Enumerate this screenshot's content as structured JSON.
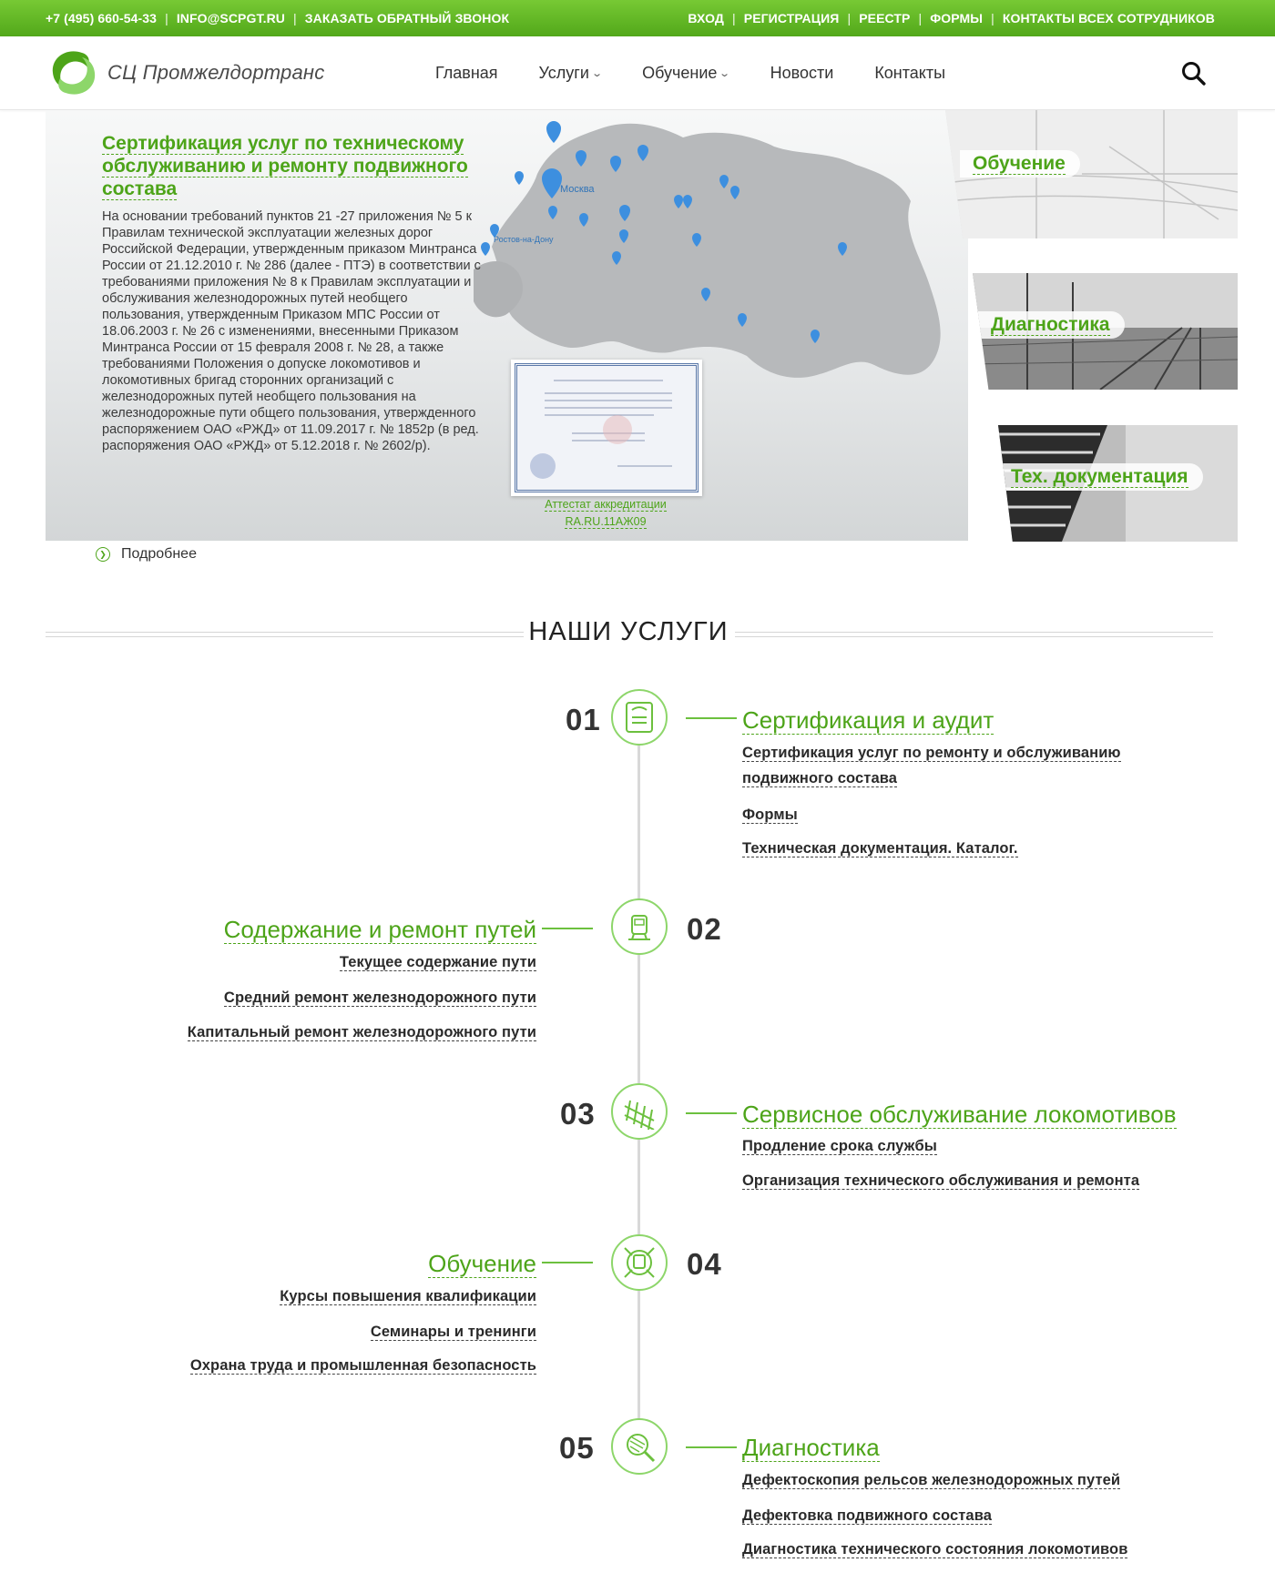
{
  "topbar": {
    "phone": "+7 (495) 660-54-33",
    "email": "INFO@SCPGT.RU",
    "callback": "ЗАКАЗАТЬ ОБРАТНЫЙ ЗВОНОК",
    "login": "ВХОД",
    "register": "РЕГИСТРАЦИЯ",
    "registry": "РЕЕСТР",
    "forms": "ФОРМЫ",
    "contacts_all": "КОНТАКТЫ ВСЕХ СОТРУДНИКОВ"
  },
  "header": {
    "logo_text": "СЦ Промжелдортранс",
    "nav": {
      "home": "Главная",
      "services": "Услуги",
      "training": "Обучение",
      "news": "Новости",
      "contacts": "Контакты"
    },
    "icons": {
      "search": "search-icon",
      "chevron": "chevron-down-icon"
    }
  },
  "hero": {
    "title": "Сертификация услуг по техническому обслуживанию и ремонту подвижного состава",
    "text": "На основании требований пунктов 21 -27 приложения № 5 к Правилам технической эксплуатации железных дорог Российской Федерации, утвержденным приказом Минтранса России от 21.12.2010 г. № 286 (далее - ПТЭ) в соответствии с требованиями приложения № 8 к Правилам эксплуатации и обслуживания железнодорожных путей необщего пользования, утвержденным Приказом МПС России от 18.06.2003 г. № 26 с изменениями, внесенными Приказом Минтранса России от 15 февраля 2008 г. № 28, а также требованиями Положения о допуске локомотивов и локомотивных бригад сторонних организаций с железнодорожных путей необщего пользования на железнодорожные пути общего пользования, утвержденного распоряжением ОАО «РЖД» от 11.09.2017 г. № 1852р (в ред. распоряжения ОАО «РЖД» от 5.12.2018 г. № 2602/р).",
    "cert_caption_1": "Аттестат аккредитации",
    "cert_caption_2": "RA.RU.11АЖ09",
    "more": "Подробнее",
    "map_labels": {
      "moscow": "Москва",
      "rostov": "Ростов-на-Дону"
    }
  },
  "tiles": {
    "training": "Обучение",
    "diagnostics": "Диагностика",
    "techdoc": "Тех. документация"
  },
  "services_title": "НАШИ УСЛУГИ",
  "services": [
    {
      "num": "01",
      "title": "Сертификация и аудит",
      "links": [
        "Сертификация услуг по ремонту и обслуживанию",
        "подвижного состава",
        "Формы",
        "Техническая документация. Каталог."
      ]
    },
    {
      "num": "02",
      "title": "Содержание и ремонт путей",
      "links": [
        "Текущее содержание пути",
        "Средний ремонт железнодорожного пути",
        "Капитальный ремонт железнодорожного пути"
      ]
    },
    {
      "num": "03",
      "title": "Сервисное обслуживание локомотивов",
      "links": [
        "Продление срока службы",
        "Организация технического обслуживания и ремонта"
      ]
    },
    {
      "num": "04",
      "title": "Обучение",
      "links": [
        "Курсы повышения квалификации",
        "Семинары и тренинги",
        "Охрана труда и промышленная безопасность"
      ]
    },
    {
      "num": "05",
      "title": "Диагностика",
      "links": [
        "Дефектоскопия рельсов железнодорожных путей",
        "Дефектовка подвижного состава",
        "Диагностика технического состояния локомотивов"
      ]
    }
  ],
  "colors": {
    "accent": "#4da419",
    "topbar": "#5cb524"
  }
}
